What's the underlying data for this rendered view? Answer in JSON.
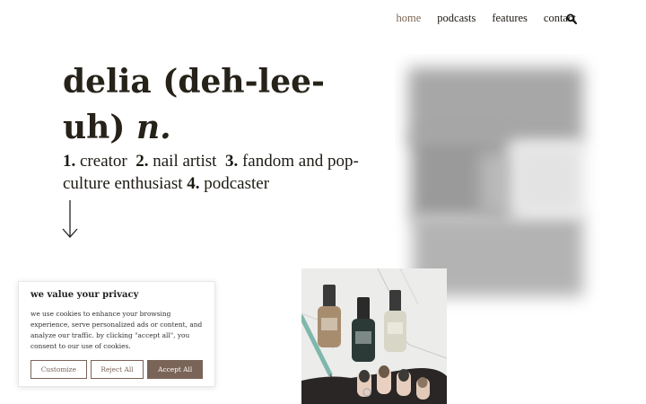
{
  "nav": {
    "items": [
      {
        "label": "home",
        "active": true
      },
      {
        "label": "podcasts",
        "active": false
      },
      {
        "label": "features",
        "active": false
      },
      {
        "label": "contact",
        "active": false
      }
    ],
    "search_icon": "search-icon"
  },
  "hero": {
    "title_line1": "delia (deh-lee-",
    "title_line2": "uh)",
    "part_of_speech": "n.",
    "definitions": [
      {
        "num": "1.",
        "text": "creator"
      },
      {
        "num": "2.",
        "text": "nail artist"
      },
      {
        "num": "3.",
        "text": "fandom and pop-culture enthusiast"
      },
      {
        "num": "4.",
        "text": "podcaster"
      }
    ],
    "arrow_icon": "arrow-down-icon"
  },
  "cookie": {
    "title": "we value your privacy",
    "text": "we use cookies to enhance your browsing experience, serve personalized ads or content, and analyze our traffic. by clicking \"accept all\", you consent to our use of cookies.",
    "customize_label": "Customize",
    "reject_label": "Reject All",
    "accept_label": "Accept All"
  },
  "colors": {
    "text": "#262219",
    "accent": "#7a6357",
    "nav_active": "#7d6555"
  }
}
